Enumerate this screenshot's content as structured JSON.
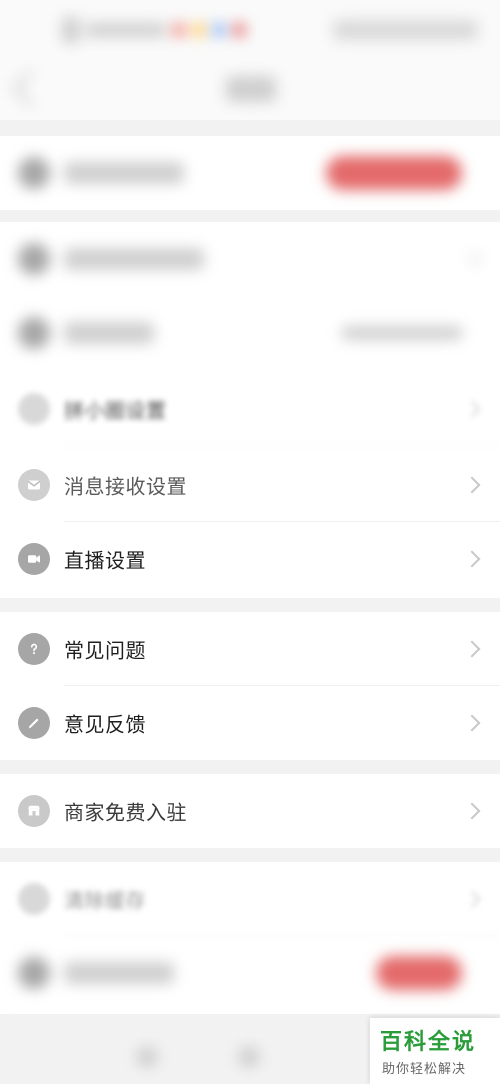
{
  "page": {
    "visible_items": [
      {
        "label": "拼小圈设置",
        "icon": "circle-icon"
      },
      {
        "label": "消息接收设置",
        "icon": "message-icon"
      },
      {
        "label": "直播设置",
        "icon": "camera-icon"
      },
      {
        "label": "常见问题",
        "icon": "question-icon"
      },
      {
        "label": "意见反馈",
        "icon": "edit-icon"
      },
      {
        "label": "商家免费入驻",
        "icon": "store-icon"
      },
      {
        "label": "清除缓存",
        "icon": "trash-icon"
      }
    ]
  },
  "watermark": {
    "top": "百科全说",
    "bottom": "助你轻松解决"
  },
  "colors": {
    "icon_bg": "#a6a6a6",
    "accent_red": "#e46a6a",
    "watermark_green": "#2a9d3a"
  }
}
